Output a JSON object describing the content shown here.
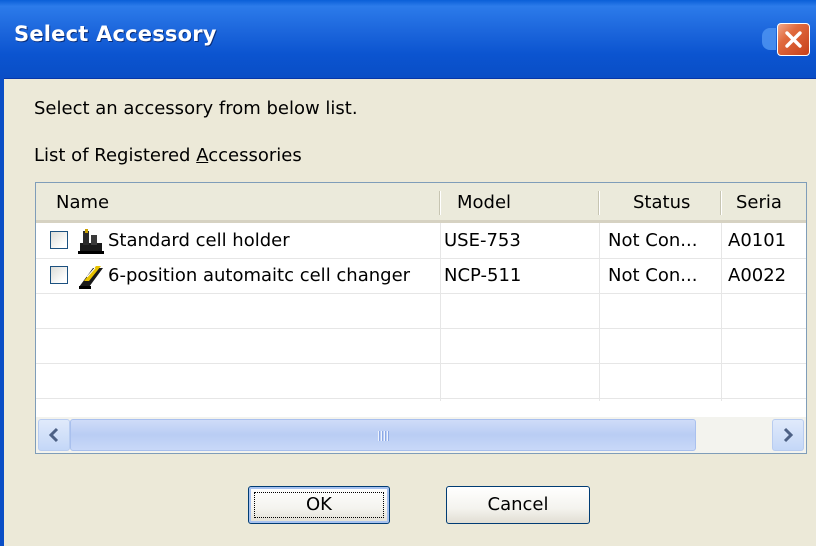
{
  "window": {
    "title": "Select Accessory"
  },
  "instruction": "Select an accessory from below list.",
  "list_label_prefix": "List of Registered ",
  "list_label_mnemonic": "A",
  "list_label_suffix": "ccessories",
  "columns": [
    "Name",
    "Model",
    "Status",
    "Seria"
  ],
  "rows": [
    {
      "name": "Standard cell holder",
      "model": "USE-753",
      "status": "Not Con...",
      "serial": "A0101",
      "checked": false,
      "icon": "cell-holder-icon"
    },
    {
      "name": "6-position automaitc cell changer",
      "model": "NCP-511",
      "status": "Not Con...",
      "serial": "A0022",
      "checked": false,
      "icon": "cell-changer-icon"
    }
  ],
  "buttons": {
    "ok": "OK",
    "cancel": "Cancel"
  },
  "colors": {
    "titlebar": "#0A5FD8",
    "face": "#ECE9D8",
    "close": "#E06A3E"
  }
}
